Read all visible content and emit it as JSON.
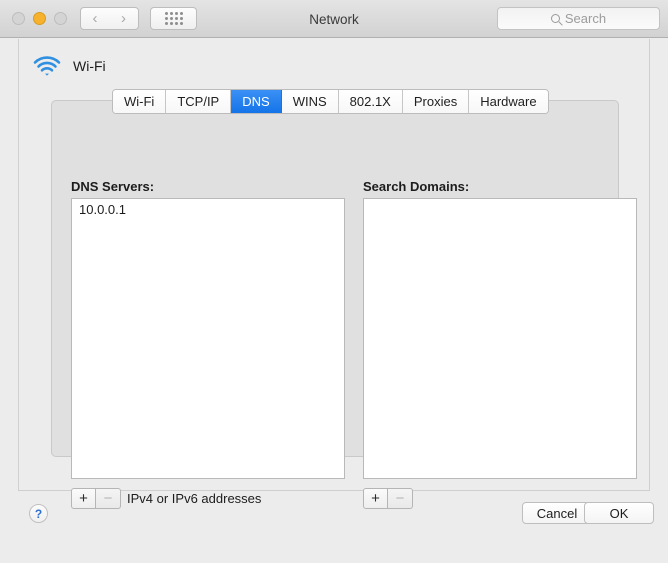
{
  "window": {
    "title": "Network",
    "traffic_lights": [
      "close",
      "minimize",
      "zoom"
    ]
  },
  "toolbar": {
    "back_glyph": "‹",
    "forward_glyph": "›",
    "show_all_name": "show-all-grid",
    "search": {
      "placeholder": "Search",
      "icon": "search-icon"
    }
  },
  "service": {
    "icon": "wifi-icon",
    "name": "Wi-Fi"
  },
  "tabs": [
    {
      "label": "Wi-Fi",
      "selected": false
    },
    {
      "label": "TCP/IP",
      "selected": false
    },
    {
      "label": "DNS",
      "selected": true
    },
    {
      "label": "WINS",
      "selected": false
    },
    {
      "label": "802.1X",
      "selected": false
    },
    {
      "label": "Proxies",
      "selected": false
    },
    {
      "label": "Hardware",
      "selected": false
    }
  ],
  "dns_servers": {
    "label": "DNS Servers:",
    "entries": [
      "10.0.0.1"
    ],
    "add_glyph": "+",
    "remove_glyph": "−",
    "hint": "IPv4 or IPv6 addresses"
  },
  "search_domains": {
    "label": "Search Domains:",
    "entries": [],
    "add_glyph": "+",
    "remove_glyph": "−"
  },
  "footer": {
    "help_glyph": "?",
    "cancel_label": "Cancel",
    "ok_label": "OK"
  },
  "colors": {
    "accent_blue": "#1474e8",
    "wifi_blue": "#1a7fe0",
    "help_blue": "#2f6fd0",
    "window_bg": "#ececec",
    "minimize_yellow": "#f7b12c"
  }
}
